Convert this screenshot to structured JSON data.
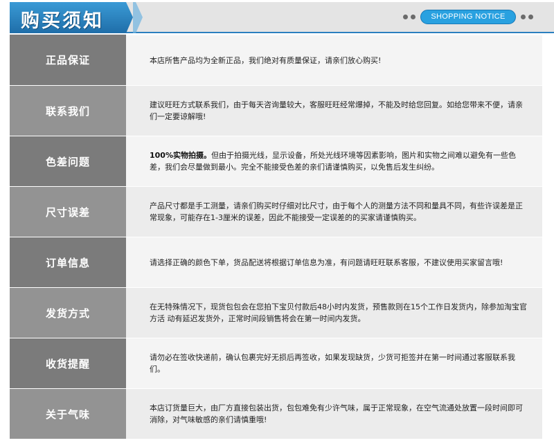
{
  "header": {
    "title": "购买须知",
    "notice": "SHOPPING NOTICE"
  },
  "colors": {
    "accent": "#2a9ee0",
    "label_bg_dark": "#7b7b7b",
    "label_bg_light": "#939393"
  },
  "rows": [
    {
      "label": "正品保证",
      "lead": "",
      "text": "本店所售产品均为全新正品，我们绝对有质量保证，请亲们放心购买!"
    },
    {
      "label": "联系我们",
      "lead": "",
      "text": "建议旺旺方式联系我们，由于每天咨询量较大，客服旺旺经常爆掉，不能及时给您回复。如给您带来不便，请亲们一定要谅解哦!"
    },
    {
      "label": "色差问题",
      "lead": "100%实物拍摄。",
      "text": "但由于拍摄光线，显示设备，所处光线环境等因素影响，图片和实物之间难以避免有一些色差，我们会尽量做到最小。完全不能接受色差的亲们请谨慎购买，以免售后发生纠纷。"
    },
    {
      "label": "尺寸误差",
      "lead": "",
      "text": "产品尺寸都是手工测量，请亲们购买时仔细对比尺寸，由于每个人的测量方法不同和量具不同，有些许误差是正常现象，可能存在1-3厘米的误差，因此不能接受一定误差的的买家请谨慎购买。"
    },
    {
      "label": "订单信息",
      "lead": "",
      "text": "请选择正确的颜色下单，货品配送将根据订单信息为准，有问题请旺旺联系客服，不建议使用买家留言哦!"
    },
    {
      "label": "发货方式",
      "lead": "",
      "text": "在无特殊情况下，现货包包会在您拍下宝贝付款后48小时内发货，预售款则在15个工作日发货内，除参加淘宝官方活 动有延迟发货外，正常时间段销售将会在第一时间内发货。"
    },
    {
      "label": "收货提醒",
      "lead": "",
      "text": "请勿必在签收快递前，确认包裹完好无损后再签收，如果发现缺货，少货可拒签并在第一时间通过客服联系我们。"
    },
    {
      "label": "关于气味",
      "lead": "",
      "text": "本店订货量巨大，由厂方直接包装出货，包包难免有少许气味，属于正常现象，在空气流通处放置一段时间即可消除，对气味敏感的亲们请慎重哦!"
    }
  ]
}
